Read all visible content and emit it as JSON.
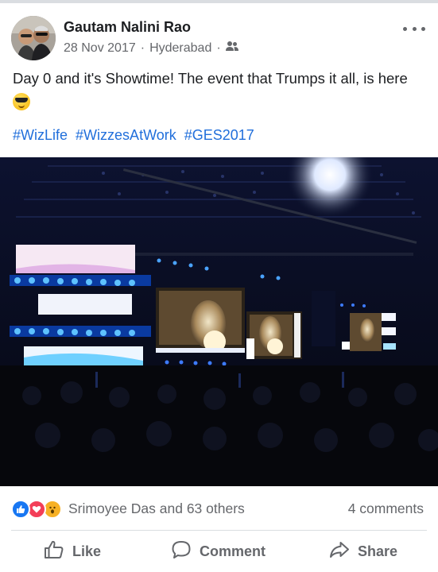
{
  "post": {
    "author": "Gautam Nalini Rao",
    "date": "28 Nov 2017",
    "separator": "·",
    "location": "Hyderabad",
    "audience_icon": "friends-icon",
    "text": "Day 0 and it's Showtime! The event that Trumps it all, is here",
    "emoji": "smiling-face-with-sunglasses",
    "hashtags": [
      "#WizLife",
      "#WizzesAtWork",
      "#GES2017"
    ],
    "photo_alt": "Conference stage with LED screens"
  },
  "engagement": {
    "reaction_icons": [
      "like-icon",
      "love-icon",
      "wow-icon"
    ],
    "reacted_by": "Srimoyee Das and 63 others",
    "comments": "4 comments"
  },
  "actions": {
    "like": "Like",
    "comment": "Comment",
    "share": "Share"
  },
  "colors": {
    "link": "#216fdb",
    "muted": "#65676b",
    "like_blue": "#1877f2",
    "love_red": "#f33e58",
    "wow_yellow": "#f7b125"
  }
}
